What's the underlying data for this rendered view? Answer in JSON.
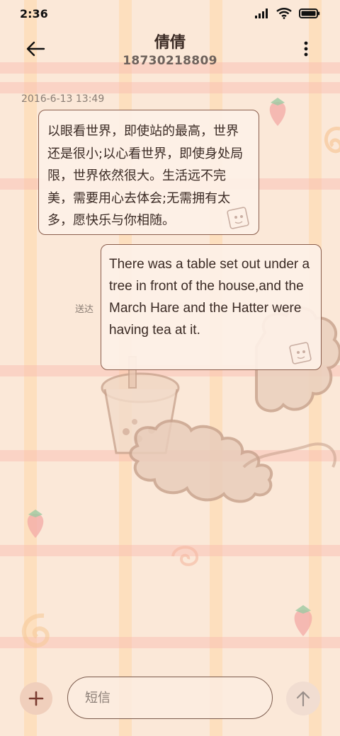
{
  "status_bar": {
    "time": "2:36",
    "icons": [
      "signal-icon",
      "wifi-icon",
      "battery-icon"
    ]
  },
  "header": {
    "back_icon": "arrow-left-icon",
    "contact_name": "倩倩",
    "contact_number": "18730218809",
    "more_icon": "more-vertical-icon"
  },
  "conversation": {
    "timestamp": "2016-6-13 13:49",
    "messages": [
      {
        "direction": "incoming",
        "text": "以眼看世界，即使站的最高，世界还是很小;以心看世界，即使身处局限，世界依然很大。生活远不完美，需要用心去体会;无需拥有太多，愿快乐与你相随。"
      },
      {
        "direction": "outgoing",
        "text": "There was a table set out under a tree in front of the house,and the March Hare and the Hatter were having tea at it.",
        "status": "送达"
      }
    ]
  },
  "input_bar": {
    "attach_icon": "plus-icon",
    "placeholder": "短信",
    "value": "",
    "send_icon": "arrow-up-icon"
  },
  "colors": {
    "bubble_border": "#8a5d4c",
    "bubble_bg": "#fdf0e6",
    "background": "#fbe8d8",
    "attach_button": "#f0cfbc",
    "text": "#3a2a24"
  }
}
